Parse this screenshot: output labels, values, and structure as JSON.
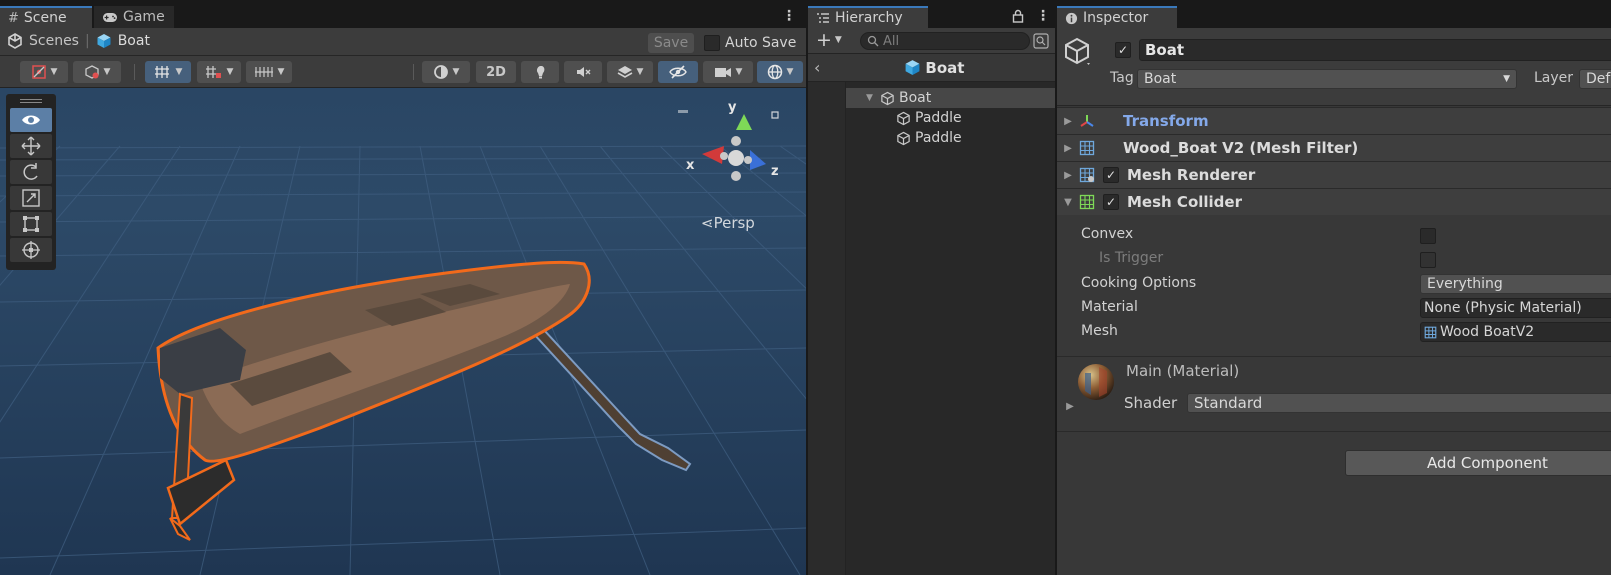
{
  "scene": {
    "tabs": [
      {
        "label": "Scene",
        "icon": "grid-hash-icon",
        "active": true
      },
      {
        "label": "Game",
        "icon": "gamepad-icon",
        "active": false
      }
    ],
    "breadcrumb": {
      "root": "Scenes",
      "current": "Boat"
    },
    "save_label": "Save",
    "auto_save_label": "Auto Save",
    "auto_save_checked": false,
    "toolbar_2d_label": "2D",
    "view_label": "Persp",
    "gizmo_axes": {
      "x": "x",
      "y": "y",
      "z": "z"
    },
    "tools": [
      "view-tool",
      "move-tool",
      "rotate-tool",
      "scale-tool",
      "rect-tool",
      "transform-tool"
    ]
  },
  "hierarchy": {
    "tab_label": "Hierarchy",
    "search_placeholder": "All",
    "header": "Boat",
    "items": [
      {
        "label": "Boat",
        "depth": 0,
        "selected": true,
        "expanded": true
      },
      {
        "label": "Paddle",
        "depth": 1,
        "selected": false
      },
      {
        "label": "Paddle",
        "depth": 1,
        "selected": false
      }
    ]
  },
  "inspector": {
    "tab_label": "Inspector",
    "object_name": "Boat",
    "active": true,
    "tag_label": "Tag",
    "tag_value": "Boat",
    "layer_label": "Layer",
    "layer_value": "Defau",
    "components": [
      {
        "name": "Transform",
        "icon": "transform-axes-icon",
        "has_toggle": false,
        "highlight": true
      },
      {
        "name": "Wood_Boat V2 (Mesh Filter)",
        "icon": "mesh-filter-icon",
        "has_toggle": false
      },
      {
        "name": "Mesh Renderer",
        "icon": "mesh-renderer-icon",
        "has_toggle": true,
        "enabled": true
      },
      {
        "name": "Mesh Collider",
        "icon": "mesh-collider-icon",
        "has_toggle": true,
        "enabled": true,
        "expanded": true
      }
    ],
    "collider_props": {
      "convex_label": "Convex",
      "convex_value": false,
      "is_trigger_label": "Is Trigger",
      "is_trigger_value": false,
      "cooking_label": "Cooking Options",
      "cooking_value": "Everything",
      "material_label": "Material",
      "material_value": "None (Physic Material)",
      "mesh_label": "Mesh",
      "mesh_value": "Wood BoatV2"
    },
    "material": {
      "name": "Main (Material)",
      "shader_label": "Shader",
      "shader_value": "Standard"
    },
    "add_component_label": "Add Component"
  },
  "colors": {
    "selection_outline": "#f26a1b",
    "transform_label": "#84a9ea",
    "tab_accent": "#3a79bb",
    "viewport_bg": "#223a55"
  }
}
